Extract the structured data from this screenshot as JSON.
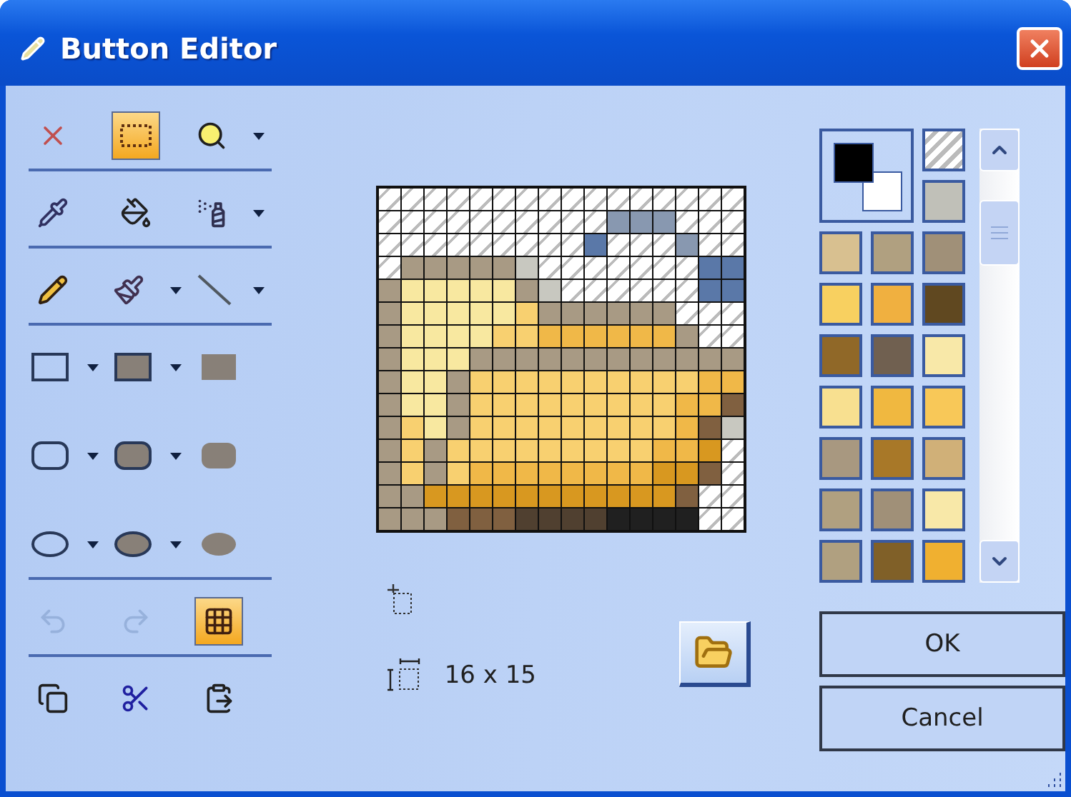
{
  "window": {
    "title": "Button Editor"
  },
  "tool_groups": [
    [
      {
        "kind": "clear",
        "selected": false,
        "disabled": false,
        "dropdown": false
      },
      {
        "kind": "select",
        "selected": true,
        "disabled": false,
        "dropdown": false
      },
      {
        "kind": "zoom",
        "selected": false,
        "disabled": false,
        "dropdown": true
      }
    ],
    [
      {
        "kind": "picker",
        "selected": false,
        "disabled": false,
        "dropdown": false
      },
      {
        "kind": "fill",
        "selected": false,
        "disabled": false,
        "dropdown": false
      },
      {
        "kind": "airbrush",
        "selected": false,
        "disabled": false,
        "dropdown": true
      }
    ],
    [
      {
        "kind": "pencil",
        "selected": false,
        "disabled": false,
        "dropdown": false
      },
      {
        "kind": "brush",
        "selected": false,
        "disabled": false,
        "dropdown": true
      },
      {
        "kind": "line",
        "selected": false,
        "disabled": false,
        "dropdown": true
      }
    ],
    [
      {
        "kind": "rect-outline",
        "selected": false,
        "disabled": false,
        "dropdown": true
      },
      {
        "kind": "rect-filled",
        "selected": false,
        "disabled": false,
        "dropdown": true
      },
      {
        "kind": "rect-solid",
        "selected": false,
        "disabled": false,
        "dropdown": false
      },
      {
        "kind": "round-outline",
        "selected": false,
        "disabled": false,
        "dropdown": true
      },
      {
        "kind": "round-filled",
        "selected": false,
        "disabled": false,
        "dropdown": true
      },
      {
        "kind": "round-solid",
        "selected": false,
        "disabled": false,
        "dropdown": false
      },
      {
        "kind": "ellipse-outline",
        "selected": false,
        "disabled": false,
        "dropdown": true
      },
      {
        "kind": "ellipse-filled",
        "selected": false,
        "disabled": false,
        "dropdown": true
      },
      {
        "kind": "ellipse-solid",
        "selected": false,
        "disabled": false,
        "dropdown": false
      }
    ],
    [
      {
        "kind": "undo",
        "selected": false,
        "disabled": true,
        "dropdown": false
      },
      {
        "kind": "redo",
        "selected": false,
        "disabled": true,
        "dropdown": false
      },
      {
        "kind": "grid",
        "selected": true,
        "disabled": false,
        "dropdown": false
      }
    ],
    [
      {
        "kind": "copy",
        "selected": false,
        "disabled": false,
        "dropdown": false
      },
      {
        "kind": "cut",
        "selected": false,
        "disabled": false,
        "dropdown": false
      },
      {
        "kind": "paste",
        "selected": false,
        "disabled": false,
        "dropdown": false
      }
    ]
  ],
  "size_label": "16 x 15",
  "current_colors": {
    "foreground": {
      "color": "#000000"
    },
    "background": {
      "color": "#ffffff"
    }
  },
  "swatches": [
    {
      "color": "#c0c0b8"
    },
    {
      "color": "#d8c090"
    },
    {
      "color": "#b0a080"
    },
    {
      "color": "#a09078"
    },
    {
      "color": "#f8d060"
    },
    {
      "color": "#f0b040"
    },
    {
      "color": "#604820"
    },
    {
      "color": "#906828"
    },
    {
      "color": "#706050"
    },
    {
      "color": "#f8e8a8"
    },
    {
      "color": "#f8e090"
    },
    {
      "color": "#f0b840"
    },
    {
      "color": "#f8c858"
    },
    {
      "color": "#a89880"
    },
    {
      "color": "#a87828"
    },
    {
      "color": "#d0b078"
    },
    {
      "color": "#b0a080"
    },
    {
      "color": "#a09078"
    },
    {
      "color": "#f8e8a8"
    },
    {
      "color": "#b0a080"
    },
    {
      "color": "#806028"
    },
    {
      "color": "#f0b030"
    }
  ],
  "buttons": [
    "OK",
    "Cancel"
  ]
}
